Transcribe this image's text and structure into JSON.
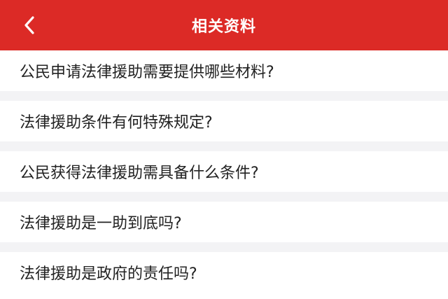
{
  "colors": {
    "header_bg": "#dc2a26",
    "header_text": "#ffffff",
    "divider_bg": "#f3f3f5",
    "item_text": "#222222"
  },
  "header": {
    "back_icon": "chevron-left-icon",
    "title": "相关资料"
  },
  "list": {
    "items": [
      {
        "label": "公民申请法律援助需要提供哪些材料?"
      },
      {
        "label": "法律援助条件有何特殊规定?"
      },
      {
        "label": "公民获得法律援助需具备什么条件?"
      },
      {
        "label": "法律援助是一助到底吗?"
      },
      {
        "label": "法律援助是政府的责任吗?"
      }
    ]
  }
}
